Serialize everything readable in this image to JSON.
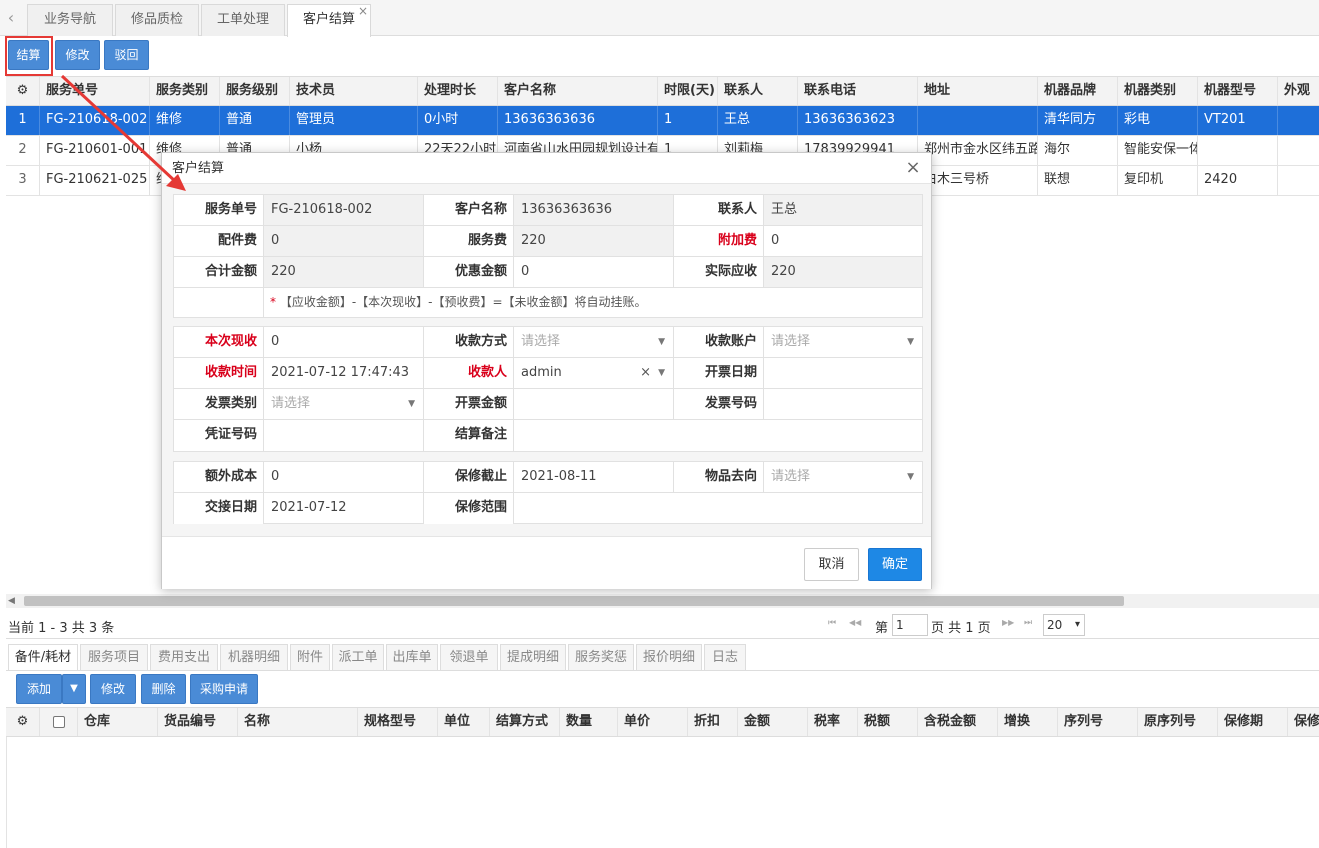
{
  "tabs": [
    {
      "label": "业务导航"
    },
    {
      "label": "修品质检"
    },
    {
      "label": "工单处理"
    },
    {
      "label": "客户结算"
    }
  ],
  "toolbar": {
    "settle": "结算",
    "modify": "修改",
    "reject": "驳回"
  },
  "grid": {
    "columns": [
      "服务单号",
      "服务类别",
      "服务级别",
      "技术员",
      "处理时长",
      "客户名称",
      "时限(天)",
      "联系人",
      "联系电话",
      "地址",
      "机器品牌",
      "机器类别",
      "机器型号",
      "外观"
    ],
    "rows": [
      [
        "1",
        "FG-210618-002",
        "维修",
        "普通",
        "管理员",
        "0小时",
        "13636363636",
        "1",
        "王总",
        "13636363623",
        "",
        "清华同方",
        "彩电",
        "VT201",
        ""
      ],
      [
        "2",
        "FG-210601-001",
        "维修",
        "普通",
        "小杨",
        "22天22小时",
        "河南省山水田园规划设计有",
        "1",
        "刘莉梅",
        "17839929941",
        "郑州市金水区纬五路",
        "海尔",
        "智能安保一体",
        "",
        ""
      ],
      [
        "3",
        "FG-210621-025",
        "维",
        "",
        "",
        "",
        "",
        "",
        "",
        "",
        "白木三号桥",
        "联想",
        "复印机",
        "2420",
        ""
      ]
    ]
  },
  "pager": {
    "summary": "当前 1 - 3 共 3 条",
    "page_label": "第",
    "page_value": "1",
    "page_total": "页 共 1 页",
    "page_size": "20",
    "first": "⏮",
    "prev": "◀◀",
    "next": "▶▶",
    "last": "⏭"
  },
  "bottom_tabs": [
    "备件/耗材",
    "服务项目",
    "费用支出",
    "机器明细",
    "附件",
    "派工单",
    "出库单",
    "领退单",
    "提成明细",
    "服务奖惩",
    "报价明细",
    "日志"
  ],
  "bottom_toolbar": {
    "add": "添加",
    "modify": "修改",
    "delete": "删除",
    "purchase": "采购申请"
  },
  "bottom_grid": {
    "columns": [
      "仓库",
      "货品编号",
      "名称",
      "规格型号",
      "单位",
      "结算方式",
      "数量",
      "单价",
      "折扣",
      "金额",
      "税率",
      "税额",
      "含税金额",
      "增换",
      "序列号",
      "原序列号",
      "保修期",
      "保修截"
    ]
  },
  "dialog": {
    "title": "客户结算",
    "s1": {
      "service_no_label": "服务单号",
      "service_no": "FG-210618-002",
      "customer_label": "客户名称",
      "customer": "13636363636",
      "contact_label": "联系人",
      "contact": "王总",
      "parts_fee_label": "配件费",
      "parts_fee": "0",
      "service_fee_label": "服务费",
      "service_fee": "220",
      "extra_fee_label": "附加费",
      "extra_fee": "0",
      "total_label": "合计金额",
      "total": "220",
      "discount_label": "优惠金额",
      "discount": "0",
      "actual_label": "实际应收",
      "actual": "220",
      "note_star": "*",
      "note": "【应收金额】-【本次现收】-【预收费】=【未收金额】将自动挂账。"
    },
    "s2": {
      "cash_label": "本次现收",
      "cash": "0",
      "pay_method_label": "收款方式",
      "pay_method_ph": "请选择",
      "account_label": "收款账户",
      "account_ph": "请选择",
      "pay_time_label": "收款时间",
      "pay_time": "2021-07-12 17:47:43",
      "payee_label": "收款人",
      "payee": "admin",
      "invoice_date_label": "开票日期",
      "invoice_date": "",
      "invoice_type_label": "发票类别",
      "invoice_type_ph": "请选择",
      "invoice_amount_label": "开票金额",
      "invoice_amount": "",
      "invoice_no_label": "发票号码",
      "invoice_no": "",
      "voucher_label": "凭证号码",
      "voucher": "",
      "remark_label": "结算备注",
      "remark": ""
    },
    "s3": {
      "extra_cost_label": "额外成本",
      "extra_cost": "0",
      "warranty_end_label": "保修截止",
      "warranty_end": "2021-08-11",
      "goods_label": "物品去向",
      "goods_ph": "请选择",
      "delivery_label": "交接日期",
      "delivery": "2021-07-12",
      "warranty_scope_label": "保修范围",
      "warranty_scope": ""
    },
    "cancel": "取消",
    "ok": "确定",
    "close": "×"
  },
  "colors": {
    "accent": "#1e6fd9",
    "button": "#4a8bd6",
    "required": "#d9001b",
    "annotation": "#e53935"
  }
}
